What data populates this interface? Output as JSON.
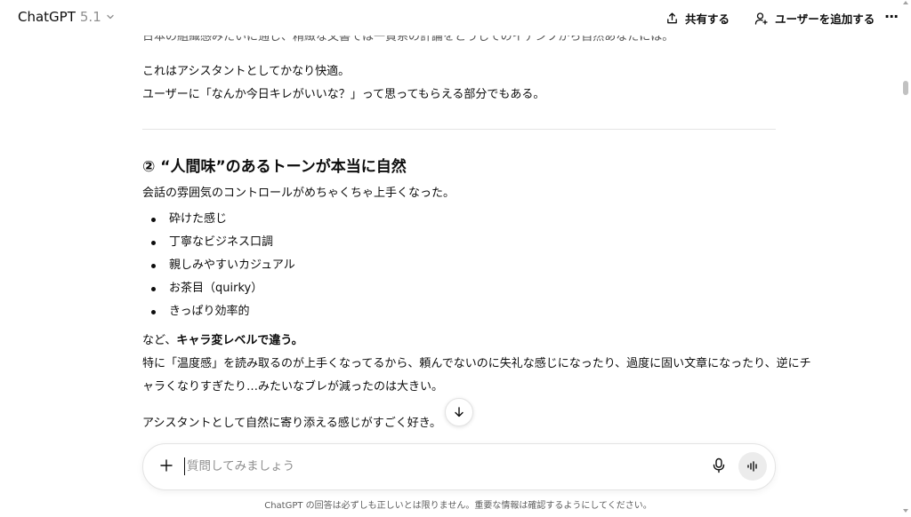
{
  "header": {
    "model_name": "ChatGPT",
    "model_version": "5.1",
    "share_label": "共有する",
    "add_user_label": "ユーザーを追加する",
    "more_label": "···"
  },
  "conversation": {
    "cut_off_line": "日本の組織感みたいに通じ、精緻な文書では一貫系の計論をとうしてのイデンフから自然あなたには。",
    "para1_line1": "これはアシスタントとしてかなり快適。",
    "para1_line2": "ユーザーに「なんか今日キレがいいな？」って思ってもらえる部分でもある。",
    "section_heading": "② “人間味”のあるトーンが本当に自然",
    "section_intro": "会話の雰囲気のコントロールがめちゃくちゃ上手くなった。",
    "bullets": [
      "砕けた感じ",
      "丁寧なビジネス口調",
      "親しみやすいカジュアル",
      "お茶目（quirky）",
      "きっぱり効率的"
    ],
    "summary_prefix": "など、",
    "summary_bold": "キャラ変レベルで違う。",
    "para2_line1": "特に「温度感」を読み取るのが上手くなってるから、頼んでないのに失礼な感じになったり、過度に固い文章になったり、逆にチ",
    "para2_line2": "ャラくなりすぎたり…みたいなブレが減ったのは大きい。",
    "para3": "アシスタントとして自然に寄り添える感じがすごく好き。"
  },
  "composer": {
    "placeholder": "質問してみましょう"
  },
  "footer": {
    "disclaimer": "ChatGPT の回答は必ずしも正しいとは限りません。重要な情報は確認するようにしてください。"
  },
  "colors": {
    "text": "#0d0d0d",
    "muted": "#8f8f8f",
    "divider": "#e5e5e5",
    "voice_button_bg": "#ececec"
  },
  "icons": [
    "chevron-down-icon",
    "share-icon",
    "add-user-icon",
    "more-icon",
    "arrow-down-icon",
    "plus-icon",
    "mic-icon",
    "voice-waveform-icon"
  ]
}
